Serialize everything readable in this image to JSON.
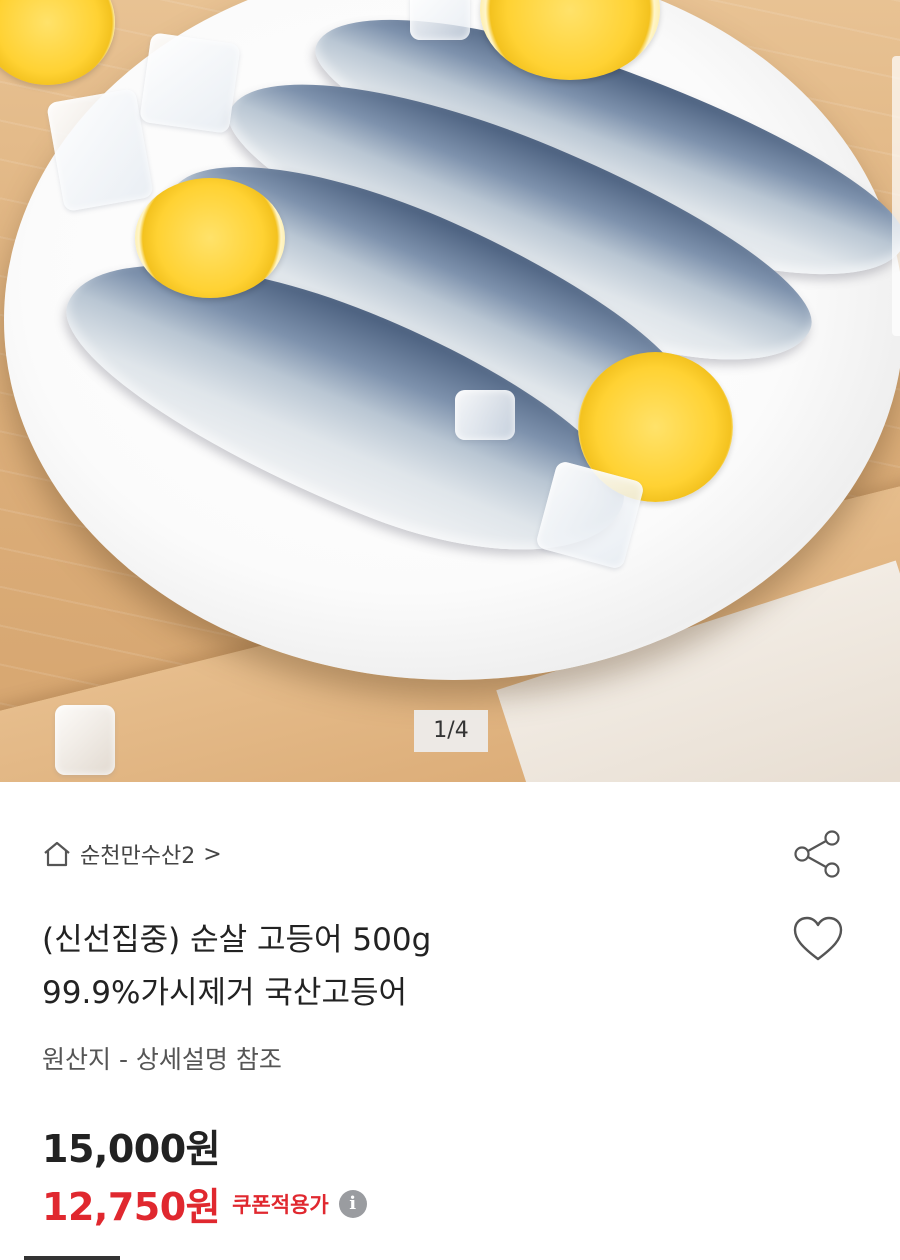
{
  "gallery": {
    "counter": "1/4",
    "image_description_icon": "product-photo"
  },
  "seller": {
    "icon": "home-icon",
    "name": "순천만수산2",
    "chevron": ">"
  },
  "actions": {
    "share_icon": "share-icon",
    "like_icon": "heart-icon"
  },
  "product": {
    "title_line1": "(신선집중) 순살 고등어 500g",
    "title_line2": "99.9%가시제거 국산고등어",
    "origin": "원산지 - 상세설명 참조"
  },
  "price": {
    "original": "15,000원",
    "sale": "12,750원",
    "coupon_label": "쿠폰적용가",
    "info_glyph": "i",
    "sale_color": "#e0282f"
  }
}
